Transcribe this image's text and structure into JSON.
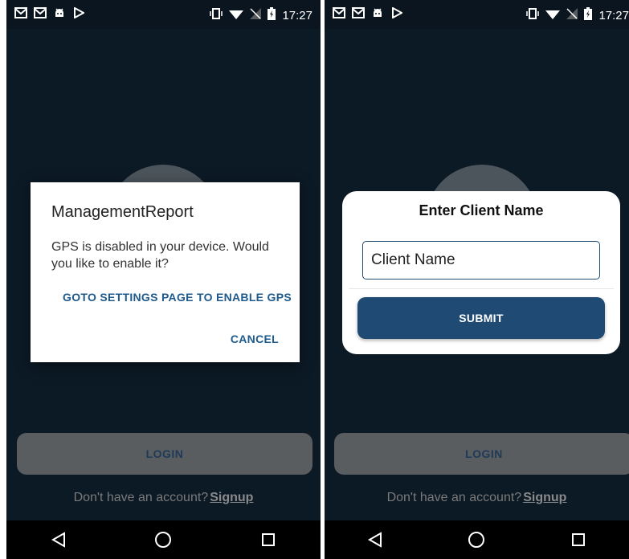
{
  "status_bar": {
    "time": "17:27"
  },
  "left_screen": {
    "dialog": {
      "title": "ManagementReport",
      "message": "GPS is disabled in your device. Would you like to enable it?",
      "settings_action": "GOTO SETTINGS PAGE TO ENABLE GPS",
      "cancel_action": "CANCEL"
    },
    "login_label": "LOGIN",
    "signup_prompt": "Don't have an account?",
    "signup_link": "Signup"
  },
  "right_screen": {
    "modal": {
      "title": "Enter Client Name",
      "input_placeholder": "Client Name",
      "submit_label": "SUBMIT"
    },
    "login_label": "LOGIN",
    "signup_prompt": "Don't have an account?",
    "signup_link": "Signup"
  },
  "colors": {
    "background": "#0c1a26",
    "primary": "#1e4a74",
    "login_button": "#5a5d60"
  },
  "icons": [
    "mail-icon",
    "mail-icon",
    "android-icon",
    "play-store-icon",
    "vibrate-icon",
    "wifi-icon",
    "no-signal-icon",
    "battery-icon",
    "back-icon",
    "home-icon",
    "recents-icon"
  ]
}
